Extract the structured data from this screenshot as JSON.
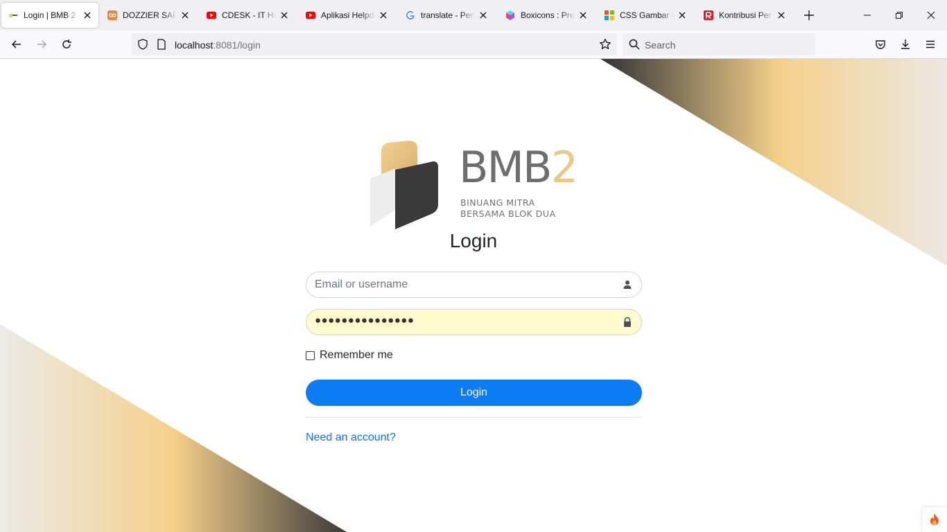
{
  "browser": {
    "tabs": [
      {
        "title": "Login | BMB 2",
        "icon": "bmb-favicon"
      },
      {
        "title": "DOZZIER SAR Log",
        "icon": "dozzle-favicon"
      },
      {
        "title": "CDESK - IT Help",
        "icon": "youtube-icon"
      },
      {
        "title": "Aplikasi Helpdesk",
        "icon": "youtube-icon"
      },
      {
        "title": "translate - Penel",
        "icon": "google-icon"
      },
      {
        "title": "Boxicons : Premi",
        "icon": "boxicons-favicon"
      },
      {
        "title": "CSS Gambar Opa",
        "icon": "w3-favicon"
      },
      {
        "title": "Kontribusi Perad",
        "icon": "r-favicon"
      }
    ],
    "address": {
      "host": "localhost",
      "rest": ":8081/login"
    },
    "search_placeholder": "Search"
  },
  "logo": {
    "word_main": "BMB",
    "word_num": "2",
    "subtitle_line1": "BINUANG MITRA",
    "subtitle_line2": "BERSAMA BLOK DUA"
  },
  "login": {
    "title": "Login",
    "username_placeholder": "Email or username",
    "password_masked": "●●●●●●●●●●●●●●●",
    "remember_label": "Remember me",
    "remember_checked": false,
    "submit_label": "Login",
    "register_link": "Need an account?"
  },
  "colors": {
    "accent_blue": "#0d7cf2",
    "link_blue": "#0d6efd",
    "gold": "#f5d08a",
    "dark": "#3a3a3a",
    "autofill": "#fffacd"
  }
}
